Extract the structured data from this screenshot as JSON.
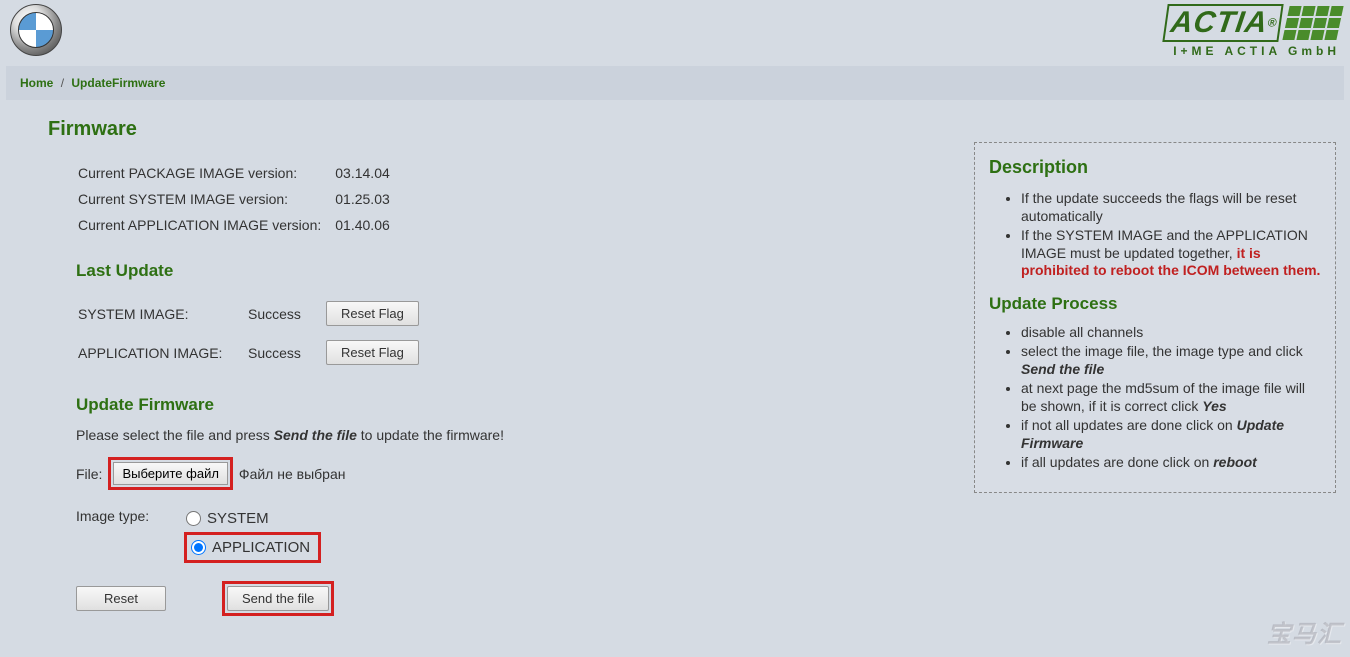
{
  "header": {
    "brand_right_main": "ACTIA",
    "brand_right_reg": "®",
    "brand_right_sub": "I+ME ACTIA GmbH"
  },
  "breadcrumb": {
    "home": "Home",
    "current": "UpdateFirmware"
  },
  "firmware": {
    "title": "Firmware",
    "versions": [
      {
        "label": "Current PACKAGE IMAGE version:",
        "value": "03.14.04"
      },
      {
        "label": "Current SYSTEM IMAGE version:",
        "value": "01.25.03"
      },
      {
        "label": "Current APPLICATION IMAGE version:",
        "value": "01.40.06"
      }
    ]
  },
  "last_update": {
    "title": "Last Update",
    "rows": [
      {
        "label": "SYSTEM IMAGE:",
        "status": "Success",
        "button": "Reset Flag"
      },
      {
        "label": "APPLICATION IMAGE:",
        "status": "Success",
        "button": "Reset Flag"
      }
    ]
  },
  "update": {
    "title": "Update Firmware",
    "instruction_pre": "Please select the file and press ",
    "instruction_bold": "Send the file",
    "instruction_post": " to update the firmware!",
    "file_label": "File:",
    "choose_file_btn": "Выберите файл",
    "no_file": "Файл не выбран",
    "image_type_label": "Image type:",
    "options": [
      {
        "value": "SYSTEM",
        "label": "SYSTEM",
        "checked": false
      },
      {
        "value": "APPLICATION",
        "label": "APPLICATION",
        "checked": true
      }
    ],
    "reset_btn": "Reset",
    "send_btn": "Send the file"
  },
  "description": {
    "title": "Description",
    "items": [
      {
        "text": "If the update succeeds the flags will be reset automatically"
      },
      {
        "pre": "If the SYSTEM IMAGE and the APPLICATION IMAGE must be updated together, ",
        "red": "it is prohibited to reboot the ICOM between them."
      }
    ],
    "process_title": "Update Process",
    "process": [
      {
        "text": "disable all channels"
      },
      {
        "pre": "select the image file, the image type and click ",
        "bold": "Send the file"
      },
      {
        "pre": "at next page the md5sum of the image file will be shown, if it is correct click ",
        "bold": "Yes"
      },
      {
        "pre": "if not all updates are done click on ",
        "bold": "Update Firmware"
      },
      {
        "pre": "if all updates are done click on ",
        "bold": "reboot"
      }
    ]
  },
  "watermark": "宝马汇"
}
